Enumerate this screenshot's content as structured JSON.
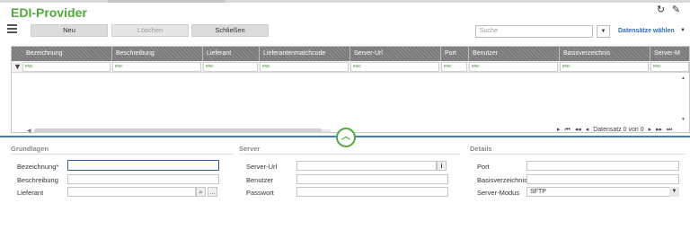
{
  "app": {
    "title": "EDI-Provider"
  },
  "icons": {
    "refresh": "refresh-icon",
    "settings": "wrench-icon",
    "menu": "hamburger-icon",
    "filter": "filter-icon"
  },
  "toolbar": {
    "new_label": "Neu",
    "delete_label": "Löschen",
    "close_label": "Schließen"
  },
  "search": {
    "placeholder": "Suche",
    "dropdown_symbol": "▼"
  },
  "datasets": {
    "label": "Datensätze wählen"
  },
  "grid": {
    "columns": [
      "Bezeichnung",
      "Beschreibung",
      "Lieferant",
      "Lieferantenmatchcode",
      "Server-Url",
      "Port",
      "Benutzer",
      "Basisverzeichnis",
      "Server-M"
    ],
    "filter_symbol": "ʀᴵᴜᴄ",
    "rows": []
  },
  "pager": {
    "text": "Datensatz 0 von 0"
  },
  "details": {
    "grundlagen": {
      "title": "Grundlagen",
      "fields": {
        "bezeichnung": "Bezeichnung*",
        "beschreibung": "Beschreibung",
        "lieferant": "Lieferant"
      }
    },
    "server": {
      "title": "Server",
      "fields": {
        "server_url": "Server-Url",
        "benutzer": "Benutzer",
        "passwort": "Passwort"
      }
    },
    "details": {
      "title": "Details",
      "fields": {
        "port": "Port",
        "basisverzeichnis": "Basisverzeichnis",
        "server_modus": "Server-Modus"
      },
      "server_modus_value": "SFTP"
    }
  },
  "colors": {
    "accent_green": "#4ea93a",
    "accent_blue": "#2c6fb5",
    "divider_blue": "#3d7fc2"
  }
}
